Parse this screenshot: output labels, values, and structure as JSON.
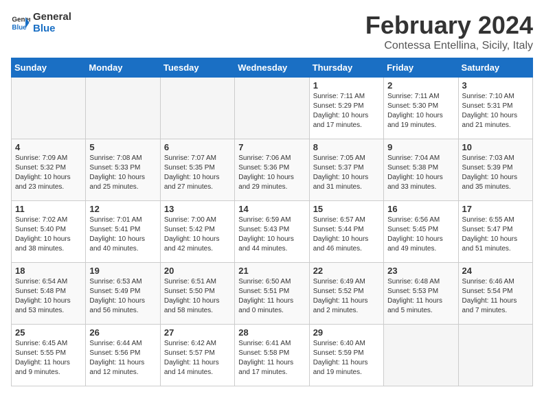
{
  "header": {
    "logo_line1": "General",
    "logo_line2": "Blue",
    "title": "February 2024",
    "subtitle": "Contessa Entellina, Sicily, Italy"
  },
  "days_of_week": [
    "Sunday",
    "Monday",
    "Tuesday",
    "Wednesday",
    "Thursday",
    "Friday",
    "Saturday"
  ],
  "weeks": [
    [
      {
        "day": "",
        "info": ""
      },
      {
        "day": "",
        "info": ""
      },
      {
        "day": "",
        "info": ""
      },
      {
        "day": "",
        "info": ""
      },
      {
        "day": "1",
        "info": "Sunrise: 7:11 AM\nSunset: 5:29 PM\nDaylight: 10 hours\nand 17 minutes."
      },
      {
        "day": "2",
        "info": "Sunrise: 7:11 AM\nSunset: 5:30 PM\nDaylight: 10 hours\nand 19 minutes."
      },
      {
        "day": "3",
        "info": "Sunrise: 7:10 AM\nSunset: 5:31 PM\nDaylight: 10 hours\nand 21 minutes."
      }
    ],
    [
      {
        "day": "4",
        "info": "Sunrise: 7:09 AM\nSunset: 5:32 PM\nDaylight: 10 hours\nand 23 minutes."
      },
      {
        "day": "5",
        "info": "Sunrise: 7:08 AM\nSunset: 5:33 PM\nDaylight: 10 hours\nand 25 minutes."
      },
      {
        "day": "6",
        "info": "Sunrise: 7:07 AM\nSunset: 5:35 PM\nDaylight: 10 hours\nand 27 minutes."
      },
      {
        "day": "7",
        "info": "Sunrise: 7:06 AM\nSunset: 5:36 PM\nDaylight: 10 hours\nand 29 minutes."
      },
      {
        "day": "8",
        "info": "Sunrise: 7:05 AM\nSunset: 5:37 PM\nDaylight: 10 hours\nand 31 minutes."
      },
      {
        "day": "9",
        "info": "Sunrise: 7:04 AM\nSunset: 5:38 PM\nDaylight: 10 hours\nand 33 minutes."
      },
      {
        "day": "10",
        "info": "Sunrise: 7:03 AM\nSunset: 5:39 PM\nDaylight: 10 hours\nand 35 minutes."
      }
    ],
    [
      {
        "day": "11",
        "info": "Sunrise: 7:02 AM\nSunset: 5:40 PM\nDaylight: 10 hours\nand 38 minutes."
      },
      {
        "day": "12",
        "info": "Sunrise: 7:01 AM\nSunset: 5:41 PM\nDaylight: 10 hours\nand 40 minutes."
      },
      {
        "day": "13",
        "info": "Sunrise: 7:00 AM\nSunset: 5:42 PM\nDaylight: 10 hours\nand 42 minutes."
      },
      {
        "day": "14",
        "info": "Sunrise: 6:59 AM\nSunset: 5:43 PM\nDaylight: 10 hours\nand 44 minutes."
      },
      {
        "day": "15",
        "info": "Sunrise: 6:57 AM\nSunset: 5:44 PM\nDaylight: 10 hours\nand 46 minutes."
      },
      {
        "day": "16",
        "info": "Sunrise: 6:56 AM\nSunset: 5:45 PM\nDaylight: 10 hours\nand 49 minutes."
      },
      {
        "day": "17",
        "info": "Sunrise: 6:55 AM\nSunset: 5:47 PM\nDaylight: 10 hours\nand 51 minutes."
      }
    ],
    [
      {
        "day": "18",
        "info": "Sunrise: 6:54 AM\nSunset: 5:48 PM\nDaylight: 10 hours\nand 53 minutes."
      },
      {
        "day": "19",
        "info": "Sunrise: 6:53 AM\nSunset: 5:49 PM\nDaylight: 10 hours\nand 56 minutes."
      },
      {
        "day": "20",
        "info": "Sunrise: 6:51 AM\nSunset: 5:50 PM\nDaylight: 10 hours\nand 58 minutes."
      },
      {
        "day": "21",
        "info": "Sunrise: 6:50 AM\nSunset: 5:51 PM\nDaylight: 11 hours\nand 0 minutes."
      },
      {
        "day": "22",
        "info": "Sunrise: 6:49 AM\nSunset: 5:52 PM\nDaylight: 11 hours\nand 2 minutes."
      },
      {
        "day": "23",
        "info": "Sunrise: 6:48 AM\nSunset: 5:53 PM\nDaylight: 11 hours\nand 5 minutes."
      },
      {
        "day": "24",
        "info": "Sunrise: 6:46 AM\nSunset: 5:54 PM\nDaylight: 11 hours\nand 7 minutes."
      }
    ],
    [
      {
        "day": "25",
        "info": "Sunrise: 6:45 AM\nSunset: 5:55 PM\nDaylight: 11 hours\nand 9 minutes."
      },
      {
        "day": "26",
        "info": "Sunrise: 6:44 AM\nSunset: 5:56 PM\nDaylight: 11 hours\nand 12 minutes."
      },
      {
        "day": "27",
        "info": "Sunrise: 6:42 AM\nSunset: 5:57 PM\nDaylight: 11 hours\nand 14 minutes."
      },
      {
        "day": "28",
        "info": "Sunrise: 6:41 AM\nSunset: 5:58 PM\nDaylight: 11 hours\nand 17 minutes."
      },
      {
        "day": "29",
        "info": "Sunrise: 6:40 AM\nSunset: 5:59 PM\nDaylight: 11 hours\nand 19 minutes."
      },
      {
        "day": "",
        "info": ""
      },
      {
        "day": "",
        "info": ""
      }
    ]
  ]
}
